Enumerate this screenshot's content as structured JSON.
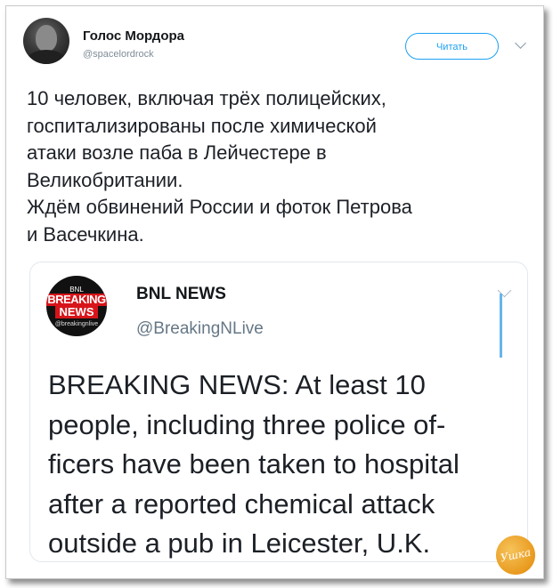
{
  "tweet": {
    "user_name": "Голос Мордора",
    "user_handle": "@spacelordrock",
    "follow_label": "Читать",
    "text_lines": [
      "10 человек, включая трёх полицейских,",
      "госпитализированы после химической",
      "атаки возле паба в Лейчестере в",
      "Великобритании.",
      "Ждём обвинений России и фоток Петрова",
      "и Васечкина."
    ]
  },
  "quoted": {
    "avatar_text": {
      "top": "BNL",
      "line1": "BREAKING",
      "line2": "NEWS",
      "handle": "@breakingnlive"
    },
    "name": "BNL NEWS",
    "handle": "@BreakingNLive",
    "text_lines": [
      "BREAKING NEWS: At least 10",
      "people, including three police of-",
      "ficers have been taken to hospital",
      "after a reported chemical attack",
      "outside a pub in Leicester, U.K."
    ]
  },
  "watermark_text": "Ушка",
  "colors": {
    "accent": "#1da1f2",
    "breaking_red": "#d7141a",
    "watermark": "#e99a1e"
  }
}
